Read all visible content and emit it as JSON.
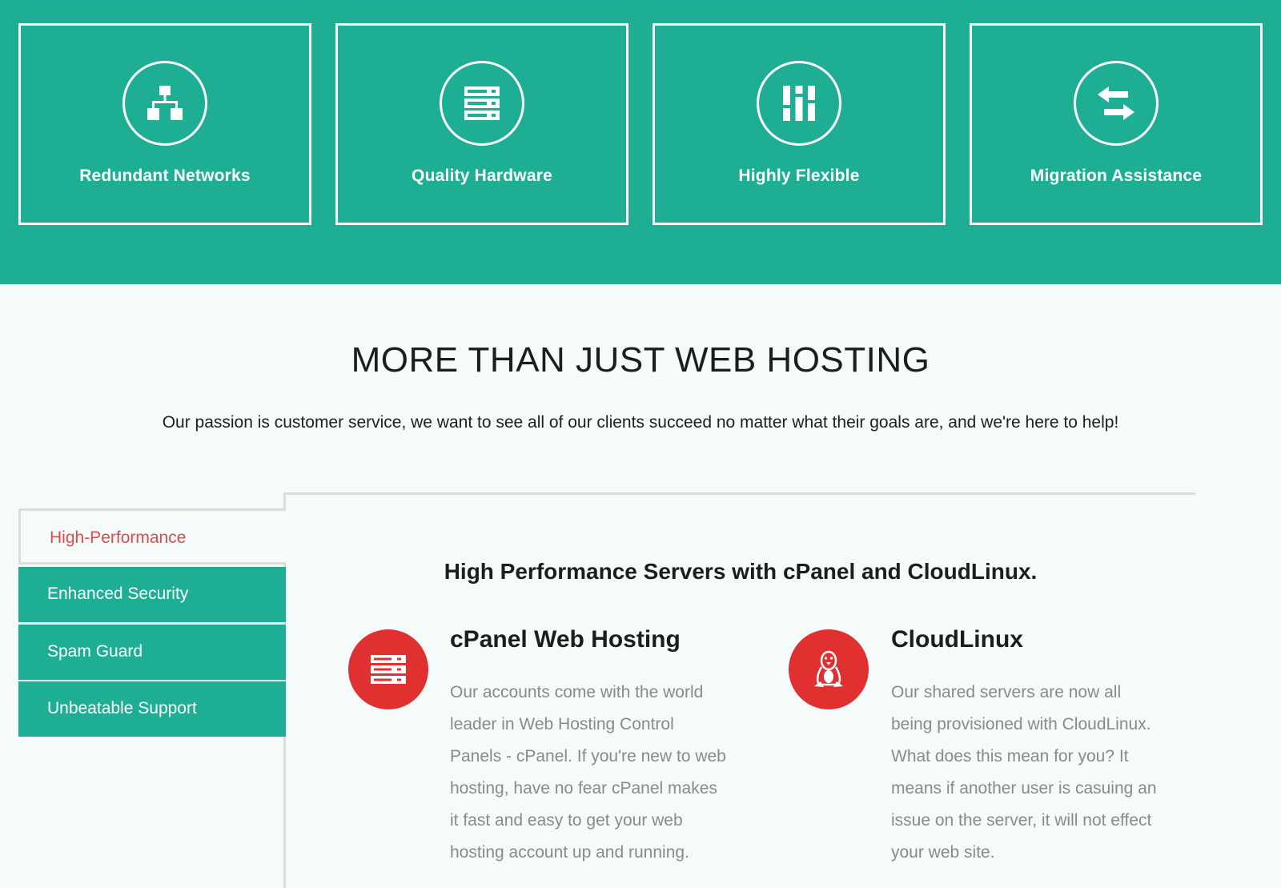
{
  "features": [
    {
      "label": "Redundant Networks",
      "icon": "network-icon"
    },
    {
      "label": "Quality Hardware",
      "icon": "server-icon"
    },
    {
      "label": "Highly Flexible",
      "icon": "sliders-icon"
    },
    {
      "label": "Migration Assistance",
      "icon": "transfer-arrows-icon"
    }
  ],
  "section": {
    "title": "MORE THAN JUST WEB HOSTING",
    "subtitle": "Our passion is customer service, we want to see all of our clients succeed no matter what their goals are, and we're here to help!"
  },
  "tabs": [
    {
      "label": "High-Performance",
      "active": true
    },
    {
      "label": "Enhanced Security",
      "active": false
    },
    {
      "label": "Spam Guard",
      "active": false
    },
    {
      "label": "Unbeatable Support",
      "active": false
    }
  ],
  "panel": {
    "heading": "High Performance Servers with cPanel and CloudLinux.",
    "columns": [
      {
        "icon": "server-icon",
        "title": "cPanel Web Hosting",
        "lines": [
          "Our accounts come with the world",
          "leader in Web Hosting Control",
          "Panels - cPanel. If you're new to web",
          "hosting, have no fear cPanel makes",
          "it fast and easy to get your web",
          "hosting account up and running."
        ]
      },
      {
        "icon": "linux-penguin-icon",
        "title": "CloudLinux",
        "lines": [
          "Our shared servers are now all",
          "being provisioned with CloudLinux.",
          "What does this mean for you? It",
          "means if another user is casuing an",
          "issue on the server, it will not effect",
          "your web site."
        ]
      }
    ]
  },
  "colors": {
    "brand_green": "#1eae93",
    "accent_red": "#e03030",
    "active_tab_text": "#e04a4a"
  }
}
